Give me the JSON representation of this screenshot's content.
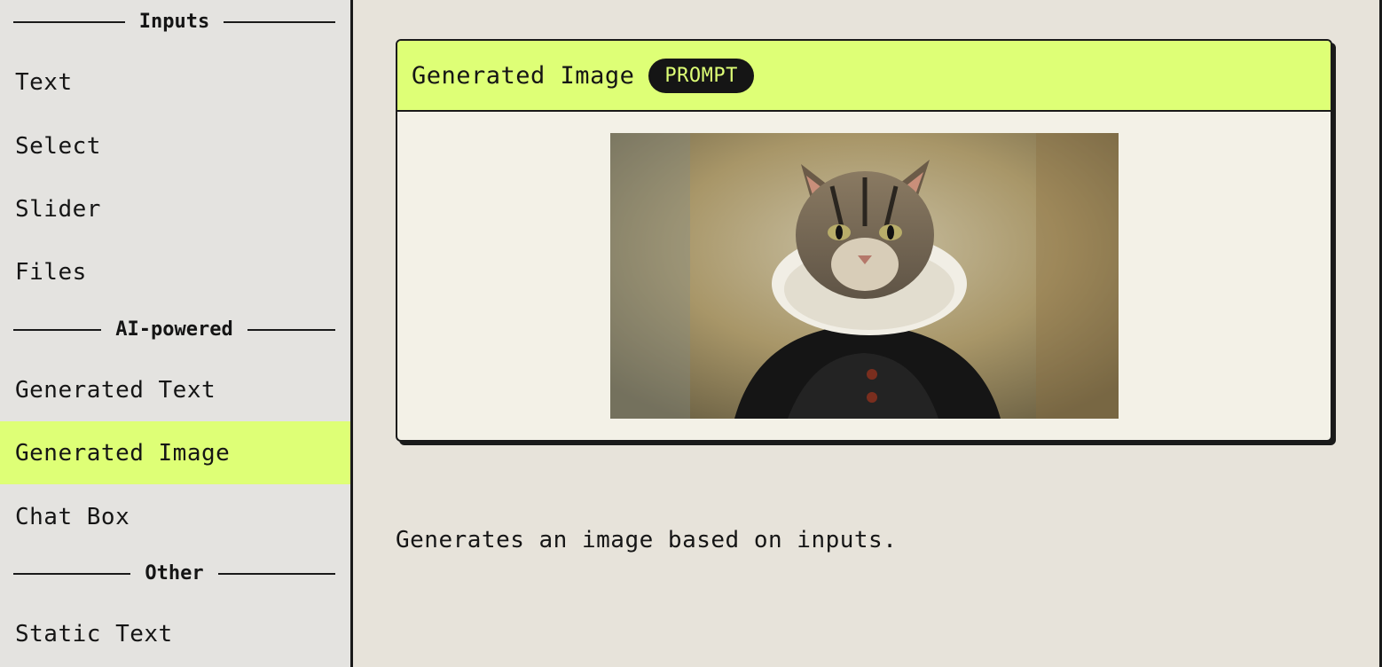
{
  "sidebar": {
    "sections": [
      {
        "header": "Inputs",
        "items": [
          "Text",
          "Select",
          "Slider",
          "Files"
        ]
      },
      {
        "header": "AI-powered",
        "items": [
          "Generated Text",
          "Generated Image",
          "Chat Box"
        ]
      },
      {
        "header": "Other",
        "items": [
          "Static Text"
        ]
      }
    ],
    "active_item": "Generated Image"
  },
  "card": {
    "title": "Generated Image",
    "badge": "PROMPT",
    "image_icon": "cat-portrait-painting"
  },
  "description": "Generates an image based on inputs.",
  "colors": {
    "accent": "#deff76",
    "page_bg": "#e7e3da",
    "sidebar_bg": "#e4e3e0",
    "card_bg": "#f3f1e7",
    "ink": "#151515"
  }
}
